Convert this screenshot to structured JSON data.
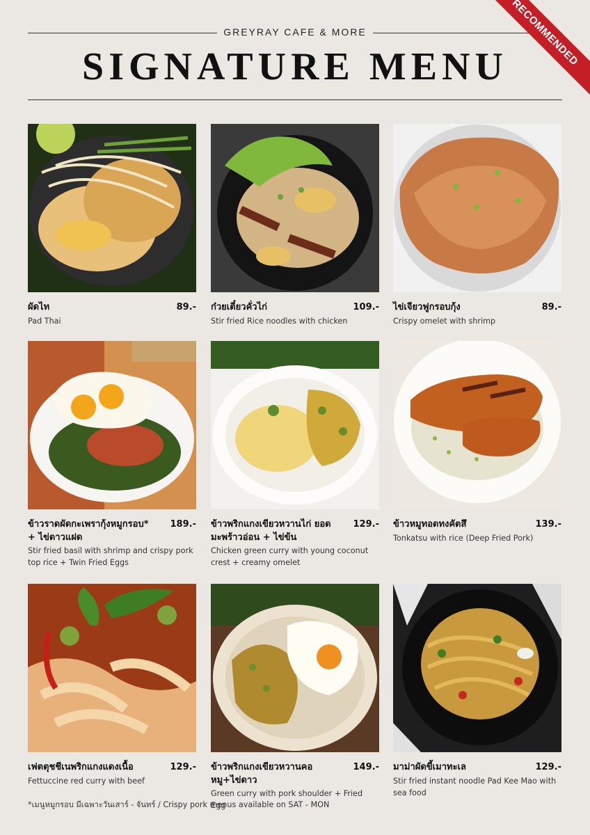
{
  "header": {
    "cafe_name": "GREYRAY CAFE & MORE",
    "title": "SIGNATURE MENU",
    "ribbon": "RECOMMENDED"
  },
  "items": [
    {
      "thai": "ผัดไท",
      "price": "89.-",
      "english": "Pad Thai"
    },
    {
      "thai": "ก๋วยเตี๋ยวคั่วไก่",
      "price": "109.-",
      "english": "Stir fried Rice noodles with chicken"
    },
    {
      "thai": "ไข่เจียวฟูกรอบกุ้ง",
      "price": "89.-",
      "english": "Crispy omelet with shrimp"
    },
    {
      "thai": "ข้าวราดผัดกะเพรากุ้งหมูกรอบ* + ไข่ดาวแฝด",
      "price": "189.-",
      "english": "Stir fried basil with shrimp and crispy pork top rice + Twin Fried Eggs"
    },
    {
      "thai": "ข้าวพริกแกงเขียวหวานไก่ ยอดมะพร้าวอ่อน + ไข่ข้น",
      "price": "129.-",
      "english": "Chicken green curry with young coconut crest +  creamy omelet"
    },
    {
      "thai": "ข้าวหมูทอดทงคัตสึ",
      "price": "139.-",
      "english": "Tonkatsu with rice (Deep Fried Pork)"
    },
    {
      "thai": "เฟตตุชชีเนพริกแกงแดงเนื้อ",
      "price": "129.-",
      "english": "Fettuccine red curry with beef"
    },
    {
      "thai": "ข้าวพริกแกงเขียวหวานคอหมู+ไข่ดาว",
      "price": "149.-",
      "english": "Green curry with pork shoulder + Fried Egg"
    },
    {
      "thai": "มาม่าผัดขี้เมาทะเล",
      "price": "129.-",
      "english": "Stir fried instant noodle Pad Kee Mao with sea food"
    }
  ],
  "footnote": "*เมนูหมูกรอบ มีเฉพาะวันเสาร์ - จันทร์ / Crispy pork menus available on SAT - MON"
}
